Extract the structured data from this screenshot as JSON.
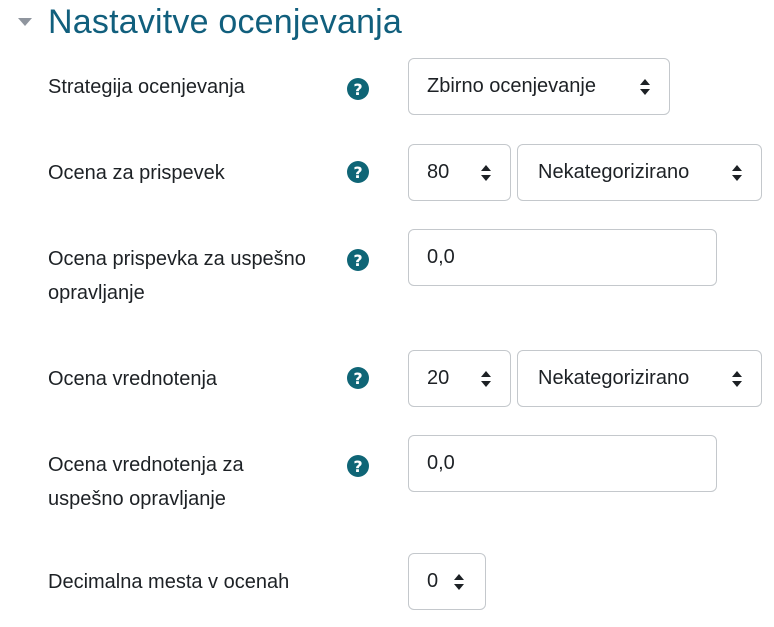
{
  "section": {
    "title": "Nastavitve ocenjevanja",
    "expanded": true
  },
  "fields": {
    "grading_strategy": {
      "label": "Strategija ocenjevanja",
      "value": "Zbirno ocenjevanje"
    },
    "submission_grade": {
      "label": "Ocena za prispevek",
      "value": "80",
      "category": "Nekategorizirano"
    },
    "submission_pass_grade": {
      "label_line1": "Ocena prispevka za uspešno",
      "label_line2": "opravljanje",
      "value": "0,0"
    },
    "assessment_grade": {
      "label": "Ocena vrednotenja",
      "value": "20",
      "category": "Nekategorizirano"
    },
    "assessment_pass_grade": {
      "label_line1": "Ocena vrednotenja za",
      "label_line2": "uspešno opravljanje",
      "value": "0,0"
    },
    "decimal_places": {
      "label": "Decimalna mesta v ocenah",
      "value": "0"
    }
  },
  "help_icon_glyph": "?",
  "colors": {
    "title": "#115f7d",
    "help_icon": "#0f6576",
    "border": "#c4c8cc",
    "text": "#1d2125"
  }
}
